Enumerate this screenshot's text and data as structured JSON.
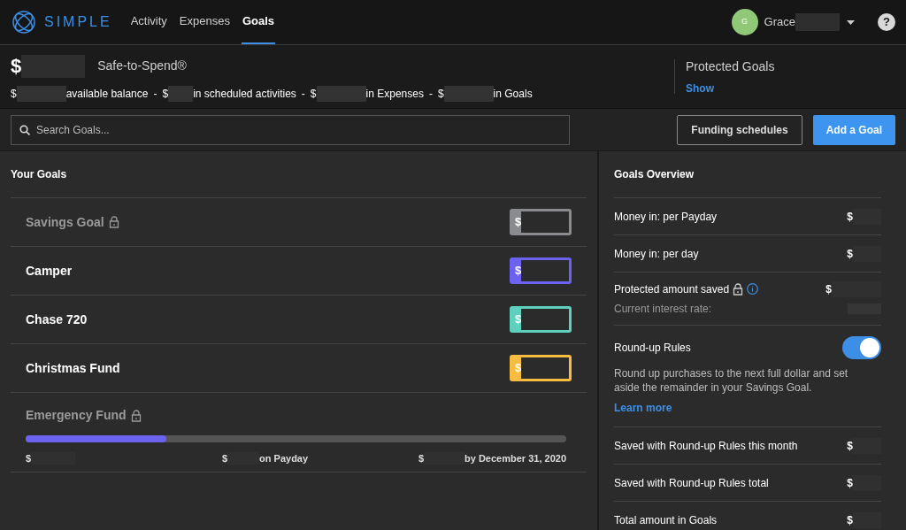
{
  "nav": {
    "logo": "SIMPLE",
    "tabs": [
      {
        "label": "Activity",
        "selected": false
      },
      {
        "label": "Expenses",
        "selected": false
      },
      {
        "label": "Goals",
        "selected": true
      }
    ],
    "user": {
      "initial": "G",
      "name": "Grace"
    },
    "help": "?"
  },
  "summary": {
    "currency": "$",
    "label": "Safe-to-Spend®",
    "separator": "-",
    "breakdown": [
      {
        "currency": "$",
        "label": "available balance"
      },
      {
        "currency": "$",
        "label": "in scheduled activities"
      },
      {
        "currency": "$",
        "label": "in Expenses"
      },
      {
        "currency": "$",
        "label": "in Goals"
      }
    ],
    "protected": {
      "title": "Protected Goals",
      "link": "Show"
    }
  },
  "search": {
    "placeholder": "Search Goals..."
  },
  "buttons": [
    {
      "label": "Funding schedules",
      "kind": "outline"
    },
    {
      "label": "Add a Goal",
      "kind": "primary"
    }
  ],
  "goals_panel": {
    "title": "Your Goals",
    "goals": [
      {
        "kind": "amount",
        "name": "Savings Goal",
        "locked": true,
        "color": "#8a8b8f",
        "currency": "$"
      },
      {
        "kind": "amount",
        "name": "Camper",
        "locked": false,
        "color": "#6b63f0",
        "currency": "$"
      },
      {
        "kind": "amount",
        "name": "Chase 720",
        "locked": false,
        "color": "#5fd0bd",
        "currency": "$"
      },
      {
        "kind": "amount",
        "name": "Christmas Fund",
        "locked": false,
        "color": "#f6bd41",
        "currency": "$"
      },
      {
        "kind": "progress",
        "name": "Emergency Fund",
        "locked": true,
        "color": "#6b63f0",
        "level": 0.26,
        "saved": "$",
        "payday": "$",
        "payday_label": "on Payday",
        "target": "$",
        "target_label": "by December 31, 2020"
      }
    ]
  },
  "overview": {
    "title": "Goals Overview",
    "rows": [
      {
        "kind": "amount",
        "label": "Money in: per Payday",
        "currency": "$"
      },
      {
        "kind": "amount",
        "label": "Money in: per day",
        "currency": "$"
      },
      {
        "kind": "protected",
        "label": "Protected amount saved",
        "currency": "$",
        "sublabel": "Current interest rate:"
      },
      {
        "kind": "toggle",
        "label": "Round-up Rules",
        "on": true,
        "description": "Round up purchases to the next full dollar and set aside the remainder in your Savings Goal.",
        "link": "Learn more"
      },
      {
        "kind": "amount",
        "label": "Saved with Round-up Rules this month",
        "currency": "$"
      },
      {
        "kind": "amount",
        "label": "Saved with Round-up Rules total",
        "currency": "$"
      },
      {
        "kind": "amount",
        "label": "Total amount in Goals",
        "currency": "$"
      }
    ]
  }
}
